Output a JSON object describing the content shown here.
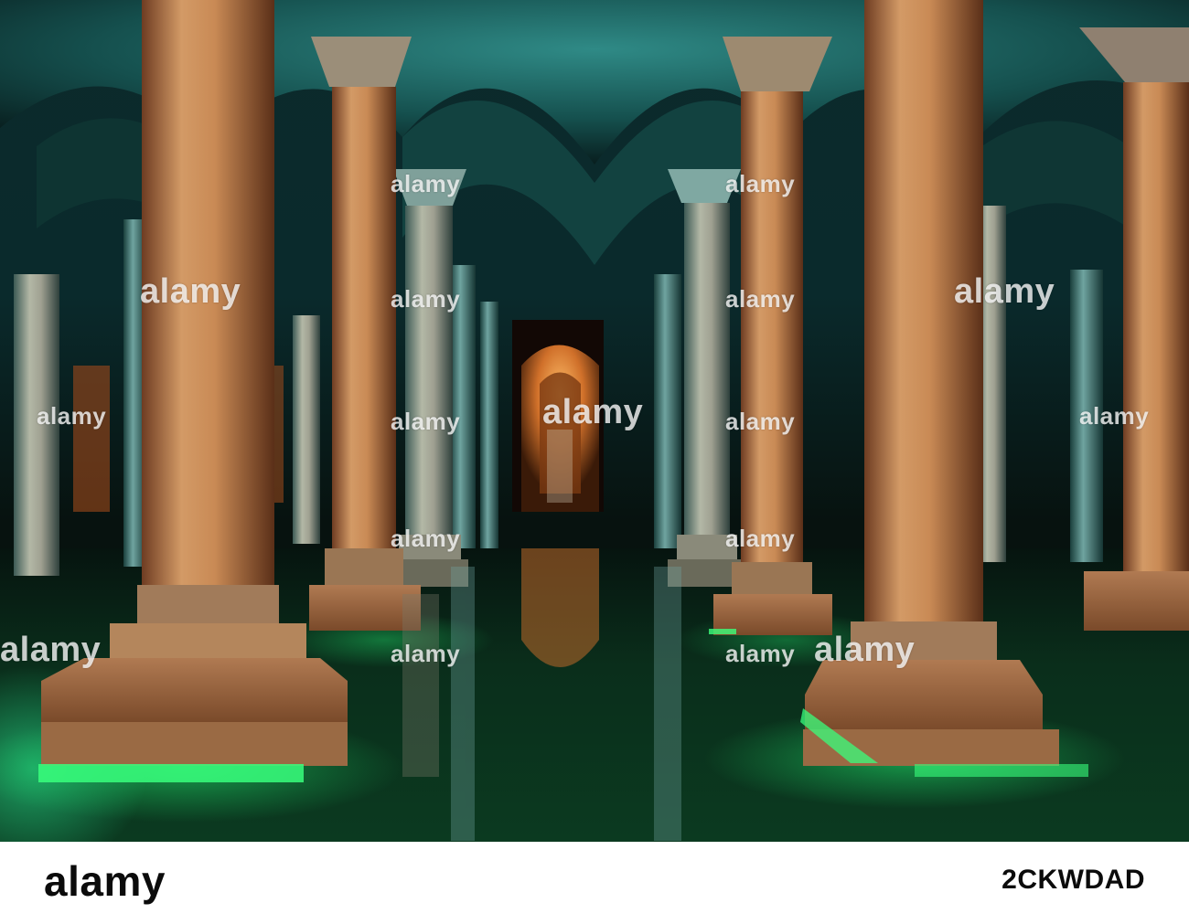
{
  "watermark": {
    "text": "alamy"
  },
  "footer": {
    "brand": "alamy",
    "stock_id": "2CKWDAD"
  },
  "palette": {
    "vault_teal": "#1d6f6b",
    "column_warm": "#c98a55",
    "water_green": "#1fd66a",
    "corridor_glow": "#ff9a3c"
  }
}
